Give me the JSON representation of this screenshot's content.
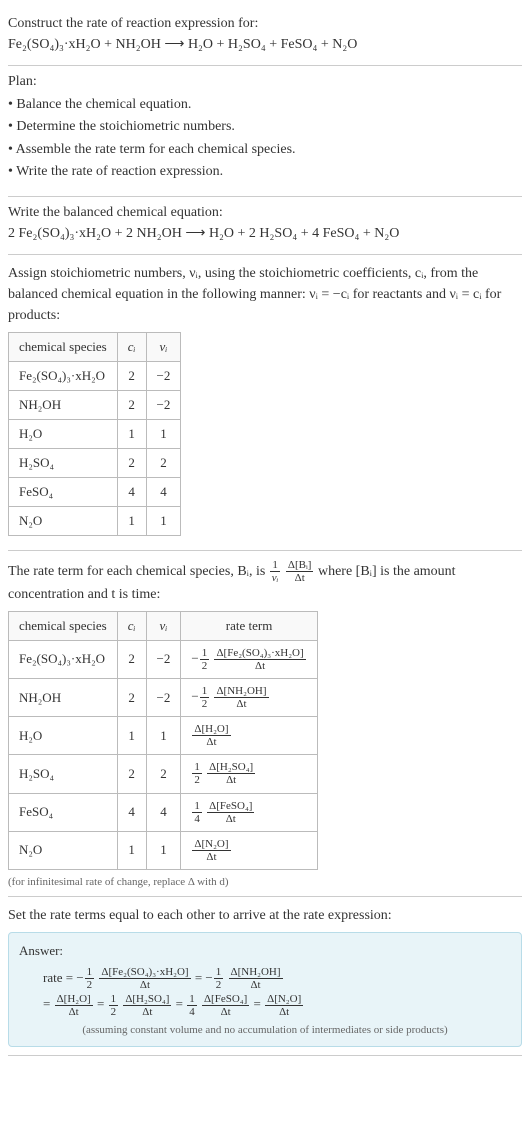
{
  "intro": {
    "title": "Construct the rate of reaction expression for:",
    "equation_lhs": "Fe₂(SO₄)₃·xH₂O + NH₂OH",
    "equation_rhs": "H₂O + H₂SO₄ + FeSO₄ + N₂O"
  },
  "plan": {
    "title": "Plan:",
    "items": [
      "Balance the chemical equation.",
      "Determine the stoichiometric numbers.",
      "Assemble the rate term for each chemical species.",
      "Write the rate of reaction expression."
    ]
  },
  "balanced": {
    "title": "Write the balanced chemical equation:",
    "equation_lhs": "2 Fe₂(SO₄)₃·xH₂O + 2 NH₂OH",
    "equation_rhs": "H₂O + 2 H₂SO₄ + 4 FeSO₄ + N₂O"
  },
  "stoich_intro": "Assign stoichiometric numbers, νᵢ, using the stoichiometric coefficients, cᵢ, from the balanced chemical equation in the following manner: νᵢ = −cᵢ for reactants and νᵢ = cᵢ for products:",
  "stoich_table": {
    "headers": [
      "chemical species",
      "cᵢ",
      "νᵢ"
    ],
    "rows": [
      [
        "Fe₂(SO₄)₃·xH₂O",
        "2",
        "−2"
      ],
      [
        "NH₂OH",
        "2",
        "−2"
      ],
      [
        "H₂O",
        "1",
        "1"
      ],
      [
        "H₂SO₄",
        "2",
        "2"
      ],
      [
        "FeSO₄",
        "4",
        "4"
      ],
      [
        "N₂O",
        "1",
        "1"
      ]
    ]
  },
  "rate_intro_a": "The rate term for each chemical species, Bᵢ, is",
  "rate_intro_frac_pre": "1",
  "rate_intro_frac_den": "νᵢ",
  "rate_intro_frac2_num": "Δ[Bᵢ]",
  "rate_intro_frac2_den": "Δt",
  "rate_intro_b": "where [Bᵢ] is the amount concentration and t is time:",
  "rate_table": {
    "headers": [
      "chemical species",
      "cᵢ",
      "νᵢ",
      "rate term"
    ],
    "rows": [
      {
        "sp": "Fe₂(SO₄)₃·xH₂O",
        "c": "2",
        "v": "−2",
        "coef": "−",
        "cn": "1",
        "cd": "2",
        "num": "Δ[Fe₂(SO₄)₃·xH₂O]",
        "den": "Δt"
      },
      {
        "sp": "NH₂OH",
        "c": "2",
        "v": "−2",
        "coef": "−",
        "cn": "1",
        "cd": "2",
        "num": "Δ[NH₂OH]",
        "den": "Δt"
      },
      {
        "sp": "H₂O",
        "c": "1",
        "v": "1",
        "coef": "",
        "cn": "",
        "cd": "",
        "num": "Δ[H₂O]",
        "den": "Δt"
      },
      {
        "sp": "H₂SO₄",
        "c": "2",
        "v": "2",
        "coef": "",
        "cn": "1",
        "cd": "2",
        "num": "Δ[H₂SO₄]",
        "den": "Δt"
      },
      {
        "sp": "FeSO₄",
        "c": "4",
        "v": "4",
        "coef": "",
        "cn": "1",
        "cd": "4",
        "num": "Δ[FeSO₄]",
        "den": "Δt"
      },
      {
        "sp": "N₂O",
        "c": "1",
        "v": "1",
        "coef": "",
        "cn": "",
        "cd": "",
        "num": "Δ[N₂O]",
        "den": "Δt"
      }
    ]
  },
  "rate_note": "(for infinitesimal rate of change, replace Δ with d)",
  "set_equal": "Set the rate terms equal to each other to arrive at the rate expression:",
  "answer": {
    "label": "Answer:",
    "pre": "rate =",
    "terms": [
      {
        "sign": "−",
        "cn": "1",
        "cd": "2",
        "num": "Δ[Fe₂(SO₄)₃·xH₂O]",
        "den": "Δt"
      },
      {
        "sign": "−",
        "cn": "1",
        "cd": "2",
        "num": "Δ[NH₂OH]",
        "den": "Δt"
      },
      {
        "sign": "",
        "cn": "",
        "cd": "",
        "num": "Δ[H₂O]",
        "den": "Δt"
      },
      {
        "sign": "",
        "cn": "1",
        "cd": "2",
        "num": "Δ[H₂SO₄]",
        "den": "Δt"
      },
      {
        "sign": "",
        "cn": "1",
        "cd": "4",
        "num": "Δ[FeSO₄]",
        "den": "Δt"
      },
      {
        "sign": "",
        "cn": "",
        "cd": "",
        "num": "Δ[N₂O]",
        "den": "Δt"
      }
    ],
    "note": "(assuming constant volume and no accumulation of intermediates or side products)"
  }
}
